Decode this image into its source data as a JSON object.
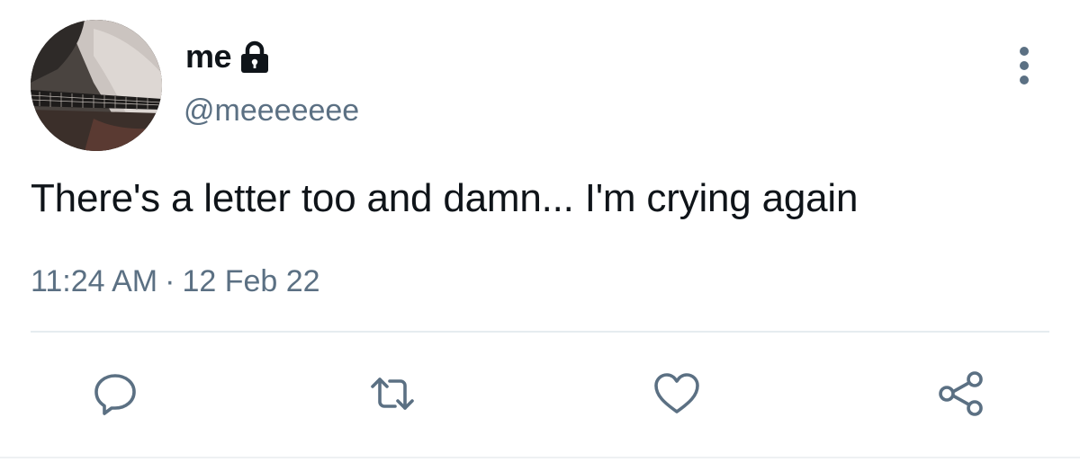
{
  "tweet": {
    "display_name": "me",
    "handle": "@meeeeeee",
    "text": "There's a letter too and damn... I'm crying again",
    "time": "11:24 AM",
    "separator": "·",
    "date": "12 Feb 22",
    "protected_icon": "lock-icon",
    "more_icon": "more-vertical-icon"
  },
  "actions": [
    {
      "name": "reply",
      "icon": "reply-icon"
    },
    {
      "name": "retweet",
      "icon": "retweet-icon"
    },
    {
      "name": "like",
      "icon": "heart-icon"
    },
    {
      "name": "share",
      "icon": "share-icon"
    }
  ],
  "colors": {
    "text_primary": "#0f1419",
    "text_secondary": "#5b7083",
    "icon": "#5b7083",
    "divider": "#e6ecf0"
  }
}
